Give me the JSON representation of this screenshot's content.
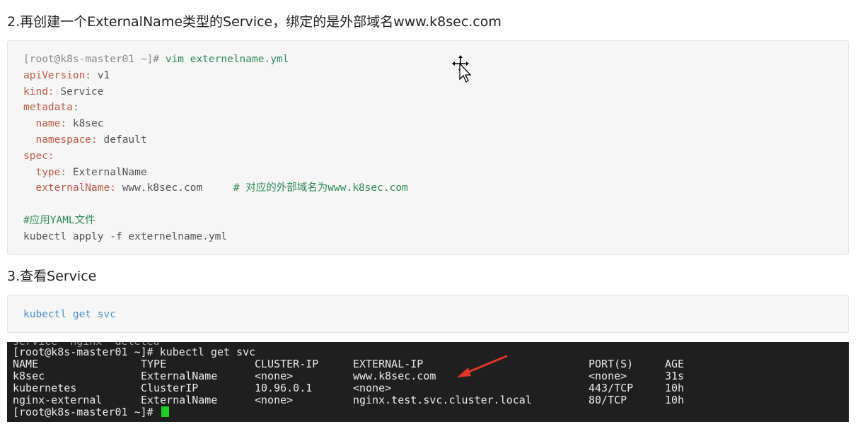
{
  "section2_heading": "2.再创建一个ExternalName类型的Service，绑定的是外部域名www.k8sec.com",
  "block1": {
    "prompt": "[root@k8s-master01 ~]# ",
    "command": "vim externelname.yml",
    "l_apiVersion_key": "apiVersion: ",
    "l_apiVersion_val": "v1",
    "l_kind_key": "kind: ",
    "l_kind_val": "Service",
    "l_metadata": "metadata:",
    "l_name_key": "  name: ",
    "l_name_val": "k8sec",
    "l_namespace_key": "  namespace: ",
    "l_namespace_val": "default",
    "l_spec": "spec:",
    "l_type_key": "  type: ",
    "l_type_val": "ExternalName",
    "l_extname_key": "  externalName: ",
    "l_extname_val": "www.k8sec.com",
    "l_extname_comment": "     # 对应的外部域名为www.k8sec.com",
    "l_comment_apply": "#应用YAML文件",
    "l_apply_cmd": "kubectl apply -f externelname.yml"
  },
  "section3_heading": "3.查看Service",
  "block2": {
    "w1": "kubectl",
    "w2": "get",
    "w3": "svc"
  },
  "terminal": {
    "cutoff_line": "service \"nginx\" deleted",
    "prompt_cmd": "[root@k8s-master01 ~]# kubectl get svc",
    "headers": [
      "NAME",
      "TYPE",
      "CLUSTER-IP",
      "EXTERNAL-IP",
      "PORT(S)",
      "AGE"
    ],
    "rows": [
      [
        "k8sec",
        "ExternalName",
        "<none>",
        "www.k8sec.com",
        "<none>",
        "31s"
      ],
      [
        "kubernetes",
        "ClusterIP",
        "10.96.0.1",
        "<none>",
        "443/TCP",
        "10h"
      ],
      [
        "nginx-external",
        "ExternalName",
        "<none>",
        "nginx.test.svc.cluster.local",
        "80/TCP",
        "10h"
      ]
    ],
    "final_prompt": "[root@k8s-master01 ~]# ",
    "cursor_color": "#19d219",
    "arrow_color": "#e0362a"
  }
}
